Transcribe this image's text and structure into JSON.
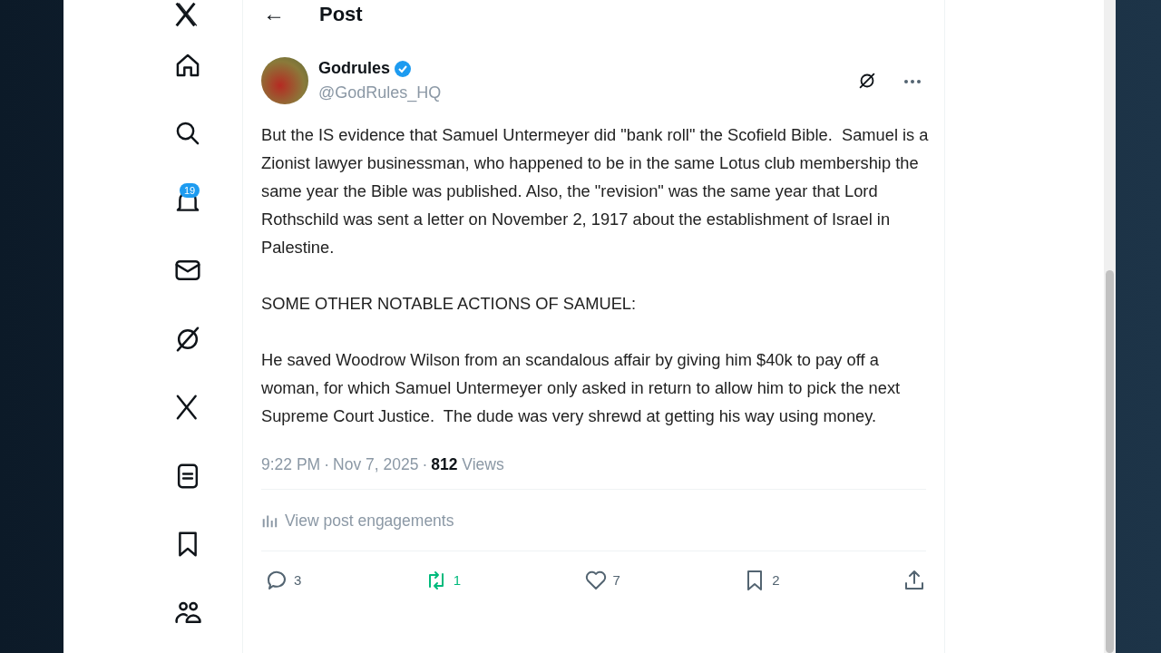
{
  "sidebar": {
    "items": [
      {
        "kind": "logo"
      },
      {
        "kind": "home"
      },
      {
        "kind": "search"
      },
      {
        "kind": "notifications",
        "badge": "19"
      },
      {
        "kind": "messages"
      },
      {
        "kind": "grok"
      },
      {
        "kind": "premium"
      },
      {
        "kind": "lists"
      },
      {
        "kind": "bookmarks"
      },
      {
        "kind": "communities"
      }
    ]
  },
  "header": {
    "back": "←",
    "title": "Post"
  },
  "post": {
    "author": {
      "name": "Godrules",
      "handle": "@GodRules_HQ",
      "verified": true
    },
    "paragraphs": [
      "But the IS evidence that Samuel Untermeyer did \"bank roll\" the Scofield Bible.  Samuel is a Zionist lawyer businessman, who happened to be in the same Lotus club membership the same year the Bible was published. Also, the \"revision\" was the same year that Lord Rothschild was sent a letter on November 2, 1917 about the establishment of Israel in Palestine.",
      "SOME OTHER NOTABLE ACTIONS OF SAMUEL:",
      "He saved Woodrow Wilson from an scandalous affair by giving him $40k to pay off a woman, for which Samuel Untermeyer only asked in return to allow him to pick the next Supreme Court Justice.  The dude was very shrewd at getting his way using money."
    ],
    "time": "9:22 PM",
    "separator_1": "·",
    "date": "Nov 7, 2025",
    "separator_2": "·",
    "views_count": "812",
    "views_label": "Views",
    "engagements": "View post engagements",
    "actions": [
      {
        "kind": "reply",
        "count": "3",
        "active": false
      },
      {
        "kind": "repost",
        "count": "1",
        "active": true
      },
      {
        "kind": "like",
        "count": "7",
        "active": false
      },
      {
        "kind": "bookmark",
        "count": "2",
        "active": false
      },
      {
        "kind": "share",
        "active": false
      }
    ]
  }
}
